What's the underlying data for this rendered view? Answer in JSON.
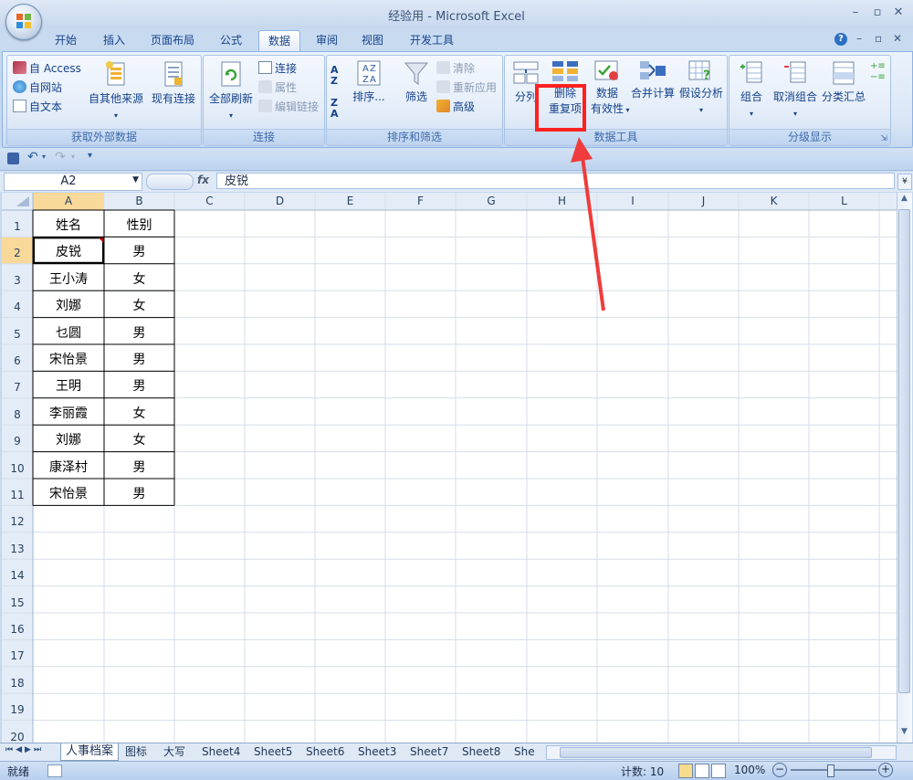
{
  "window": {
    "title": "经验用 - Microsoft Excel",
    "minimize": "–",
    "restore": "▫",
    "close": "✕"
  },
  "ribbon_tabs": [
    "开始",
    "插入",
    "页面布局",
    "公式",
    "数据",
    "审阅",
    "视图",
    "开发工具"
  ],
  "active_tab": "数据",
  "ribbon": {
    "get_external": {
      "label": "获取外部数据",
      "access": "自 Access",
      "web": "自网站",
      "text": "自文本",
      "other": "自其他来源",
      "existing": "现有连接"
    },
    "connections": {
      "label": "连接",
      "refresh_all": "全部刷新",
      "connections": "连接",
      "properties": "属性",
      "edit_links": "编辑链接"
    },
    "sort_filter": {
      "label": "排序和筛选",
      "sort": "排序...",
      "filter": "筛选",
      "clear": "清除",
      "reapply": "重新应用",
      "advanced": "高级"
    },
    "data_tools": {
      "label": "数据工具",
      "text_to_columns": "分列",
      "remove_dup_line1": "删除",
      "remove_dup_line2": "重复项",
      "validation_line1": "数据",
      "validation_line2": "有效性",
      "consolidate": "合并计算",
      "what_if": "假设分析"
    },
    "outline": {
      "label": "分级显示",
      "group": "组合",
      "ungroup": "取消组合",
      "subtotal": "分类汇总"
    }
  },
  "formula_bar": {
    "name_box": "A2",
    "fx": "fx",
    "content": "皮锐"
  },
  "columns": [
    "A",
    "B",
    "C",
    "D",
    "E",
    "F",
    "G",
    "H",
    "I",
    "J",
    "K",
    "L"
  ],
  "rows": [
    "1",
    "2",
    "3",
    "4",
    "5",
    "6",
    "7",
    "8",
    "9",
    "10",
    "11",
    "12",
    "13",
    "14",
    "15",
    "16",
    "17",
    "18",
    "19",
    "20"
  ],
  "table": {
    "header": [
      "姓名",
      "性别"
    ],
    "rows": [
      [
        "皮锐",
        "男"
      ],
      [
        "王小涛",
        "女"
      ],
      [
        "刘娜",
        "女"
      ],
      [
        "乜圆",
        "男"
      ],
      [
        "宋怡景",
        "男"
      ],
      [
        "王明",
        "男"
      ],
      [
        "李丽霞",
        "女"
      ],
      [
        "刘娜",
        "女"
      ],
      [
        "康泽村",
        "男"
      ],
      [
        "宋怡景",
        "男"
      ]
    ]
  },
  "sheet_tabs": [
    "人事档案",
    "图标",
    "大写",
    "Sheet4",
    "Sheet5",
    "Sheet6",
    "Sheet3",
    "Sheet7",
    "Sheet8",
    "She"
  ],
  "active_sheet": "人事档案",
  "status": {
    "ready": "就绪",
    "count": "计数: 10",
    "zoom": "100%"
  },
  "colors": {
    "highlight": "#ff2020",
    "ribbon_text": "#15428b"
  }
}
